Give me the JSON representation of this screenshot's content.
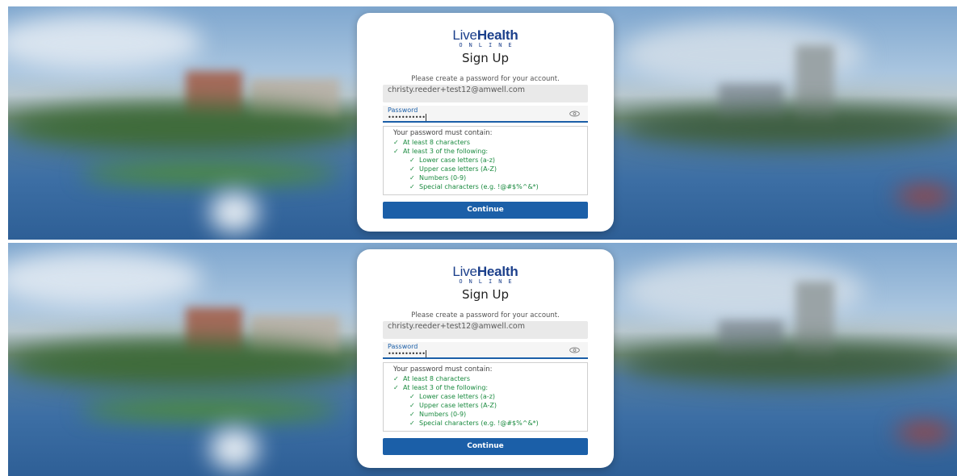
{
  "screens": [
    {
      "logo": {
        "main_light": "Live",
        "main_bold": "Health",
        "sub": "ONLINE"
      },
      "title": "Sign Up",
      "subtitle": "Please create a password for your account.",
      "email_value": "christy.reeder+test12@amwell.com",
      "password": {
        "label": "Password",
        "masked_value": "•••••••••••"
      },
      "requirements": {
        "heading": "Your password must contain:",
        "items": [
          "At least 8 characters",
          "At least 3 of the following:",
          "Lower case letters (a-z)",
          "Upper case letters (A-Z)",
          "Numbers (0-9)",
          "Special characters (e.g. !@#$%^&*)"
        ],
        "check": "✓"
      },
      "continue_label": "Continue"
    },
    {
      "logo": {
        "main_light": "Live",
        "main_bold": "Health",
        "sub": "ONLINE"
      },
      "title": "Sign Up",
      "subtitle": "Please create a password for your account.",
      "email_value": "christy.reeder+test12@amwell.com",
      "password": {
        "label": "Password",
        "masked_value": "•••••••••••"
      },
      "requirements": {
        "heading": "Your password must contain:",
        "items": [
          "At least 8 characters",
          "At least 3 of the following:",
          "Lower case letters (a-z)",
          "Upper case letters (A-Z)",
          "Numbers (0-9)",
          "Special characters (e.g. !@#$%^&*)"
        ],
        "check": "✓"
      },
      "continue_label": "Continue"
    }
  ],
  "colors": {
    "brand_blue": "#1b3f8b",
    "button_blue": "#1b5fa8",
    "check_green": "#1a8a3f"
  }
}
